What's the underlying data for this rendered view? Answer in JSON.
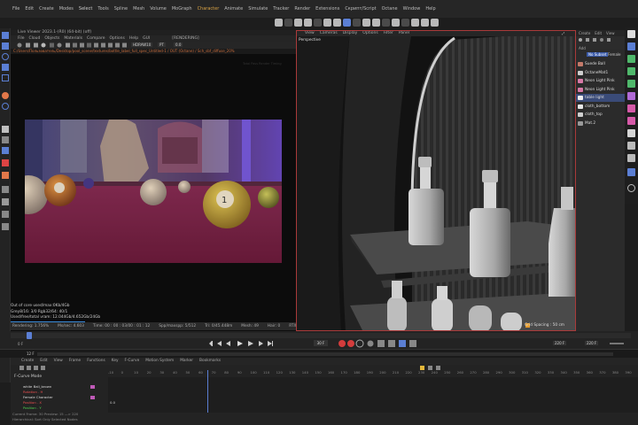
{
  "menubar": {
    "items": [
      "File",
      "Edit",
      "Create",
      "Modes",
      "Select",
      "Tools",
      "Spline",
      "Mesh",
      "Volume",
      "MoGraph",
      "Character",
      "Animate",
      "Simulate",
      "Tracker",
      "Render",
      "Extensions",
      "Скрипт/Script",
      "Octane",
      "Window",
      "Help"
    ]
  },
  "live_viewer": {
    "title": "Live Viewer 2023.1-(R0) (64-bit) (off)",
    "menu": [
      "File",
      "Cloud",
      "Objects",
      "Materials",
      "Compare",
      "Options",
      "Help",
      "GUI"
    ],
    "rendering_tag": "[RENDERING]",
    "mode_value": "HDRAW10",
    "field_a": "PT",
    "field_b": "0.0",
    "path": "C:/Users/Пользователь/Desktop/pool_scene/textures/bottle_label_full_spec_Untitled-1 / OUT (Octane) / Sch_sbf_diffuse_20%",
    "corner_note": "Total Pass Render Timing",
    "status": [
      "Out of core used/max:0Kb/4Gb",
      "Grey8/16: 3/0   Rgb32/64: 40/1",
      "Used/free/total vram: 12.044Gb/4.652Gb/24Gb"
    ],
    "status_badge": "Rendering",
    "render_bar": [
      "Rendering: 1.756%",
      "Ms/sec: 4.603",
      "Time: 00 : 00 : 03/00 : 01 : 12",
      "Spp/maxspp: 5/512",
      "Tri: 0/45.448m",
      "Mesh: 49",
      "Hair: 0",
      "RTX:on",
      "GPU: 3"
    ]
  },
  "viewport": {
    "menu": [
      "View",
      "Cameras",
      "Display",
      "Options",
      "Filter",
      "Panel"
    ],
    "label": "Perspective",
    "grid": "Grid Spacing : 50 cm"
  },
  "object_manager": {
    "menu": [
      "Create",
      "Edit",
      "View"
    ],
    "tabs": [
      "No Subset",
      "Female"
    ],
    "header": "Add",
    "objects": [
      {
        "name": "Suede Ball",
        "color": "#c47a6a"
      },
      {
        "name": "OctaneMat1",
        "color": "#cfcfcf"
      },
      {
        "name": "Neon Light Pink",
        "color": "#d87aa8"
      },
      {
        "name": "Neon Light Pink",
        "color": "#d87aa8"
      },
      {
        "name": "table light",
        "color": "#efefef"
      },
      {
        "name": "cloth_bottom",
        "color": "#e7e7e7"
      },
      {
        "name": "cloth_top",
        "color": "#d0d0d0"
      },
      {
        "name": "Mat.2",
        "color": "#9a9a9a"
      }
    ]
  },
  "playback": {
    "frame_field": "30 F",
    "field_left": "0 F",
    "field_right": "220 F",
    "range_end": "220 F",
    "start": "12 F"
  },
  "timeline": {
    "menu": [
      "Create",
      "Edit",
      "View",
      "Frame",
      "Functions",
      "Key",
      "F-Curve",
      "Motion System",
      "Marker",
      "Bookmarks"
    ],
    "title": "F-Curve Mode",
    "tracks": [
      {
        "name": "white Ball_brown",
        "color": "#dddddd",
        "key": "#c05ab8"
      },
      {
        "name": "Rotation . H",
        "color": "#e84e4e",
        "key": ""
      },
      {
        "name": "Female Character",
        "color": "#dddddd",
        "key": "#c05ab8"
      },
      {
        "name": "Position . X",
        "color": "#e84e4e",
        "key": ""
      },
      {
        "name": "Position . Y",
        "color": "#4fd04f",
        "key": ""
      }
    ],
    "value_label": "0.0",
    "ruler": [
      "-10",
      "0",
      "10",
      "20",
      "30",
      "40",
      "50",
      "60",
      "70",
      "80",
      "90",
      "100",
      "110",
      "120",
      "130",
      "140",
      "150",
      "160",
      "170",
      "180",
      "190",
      "200",
      "210",
      "220",
      "230",
      "240",
      "250",
      "260",
      "270",
      "280",
      "290",
      "300",
      "310",
      "320",
      "330",
      "340",
      "350",
      "360",
      "370",
      "380",
      "390"
    ],
    "footer": [
      "Current Frame: 30  Preview: 15 —> 220",
      "Hierarchical: Sort    Only Selected Nodes"
    ]
  },
  "colors": {
    "accent": "#5b7fd4",
    "highlight_menu": "#d8a244",
    "record": "#d33c3c",
    "badge": "#e59b2c"
  }
}
